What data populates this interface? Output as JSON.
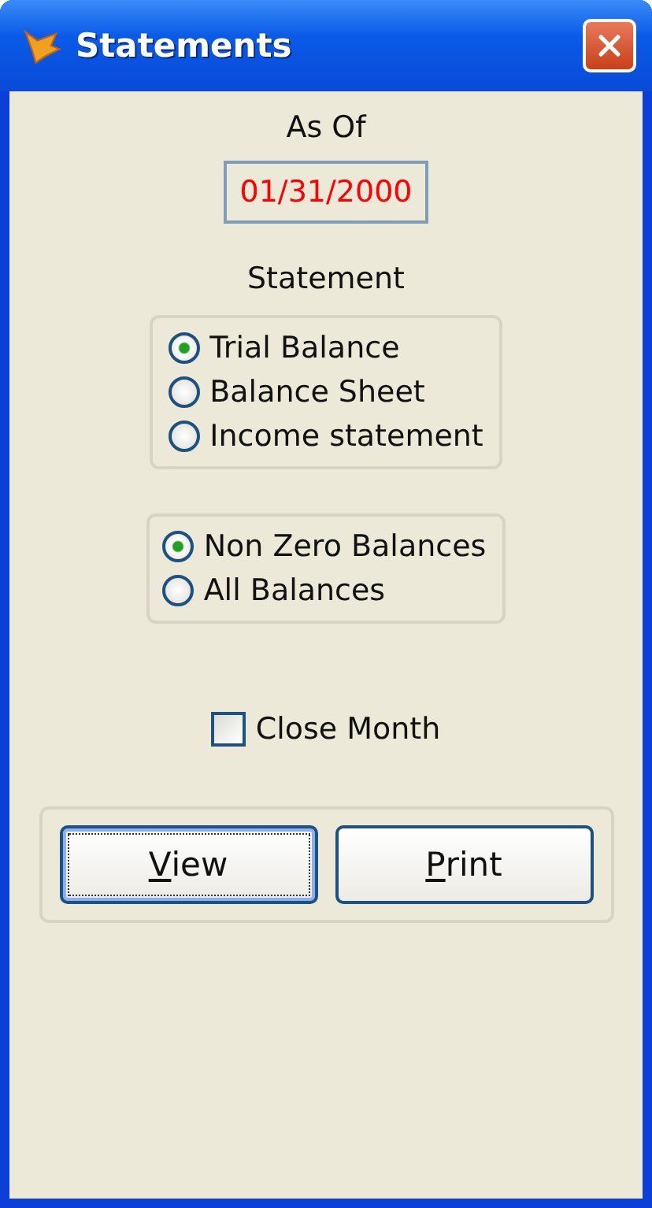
{
  "window": {
    "title": "Statements"
  },
  "as_of": {
    "label": "As Of",
    "value": "01/31/2000"
  },
  "statement": {
    "label": "Statement",
    "options": [
      {
        "label": "Trial Balance",
        "selected": true
      },
      {
        "label": "Balance Sheet",
        "selected": false
      },
      {
        "label": "Income statement",
        "selected": false
      }
    ]
  },
  "balances": {
    "options": [
      {
        "label": "Non Zero Balances",
        "selected": true
      },
      {
        "label": "All Balances",
        "selected": false
      }
    ]
  },
  "close_month": {
    "label": "Close Month",
    "checked": false
  },
  "buttons": [
    {
      "label": "View",
      "focused": true
    },
    {
      "label": "Print",
      "focused": false
    }
  ]
}
